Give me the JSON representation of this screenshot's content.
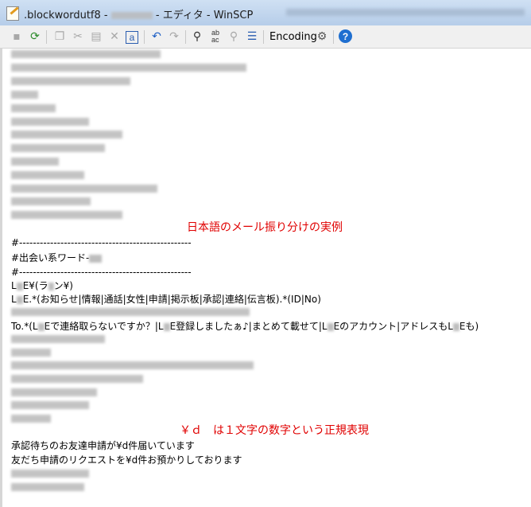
{
  "window": {
    "file_name": ".blockwordutf8 - ",
    "title_suffix": " - エディタ - WinSCP"
  },
  "toolbar": {
    "encoding_label": "Encoding",
    "help_label": "?"
  },
  "annotations": {
    "heading": "日本語のメール振り分けの実例",
    "regex_note": "￥ｄ　は１文字の数字という正規表現"
  },
  "editor": {
    "separator_1": "#--------------------------------------------------",
    "section_comment": "#出会い系ワード-",
    "separator_2": "#--------------------------------------------------",
    "line_line_a": "L",
    "line_line_b": "E¥(ラ",
    "line_line_c": "ン¥)",
    "line_keywords_a": "L",
    "line_keywords_b": "E.*(お知らせ|情報|通話|女性|申請|掲示板|承認|連絡|伝言板).*(ID|No)",
    "line_to_a": "To.*(L",
    "line_to_b": "Eで連絡取らないですか？|L",
    "line_to_c": "E登録しましたぁ♪|まとめて載せて|L",
    "line_to_d": "Eのアカウント|アドレスもL",
    "line_to_e": "Eも)",
    "line_approval": "承認待ちのお友達申請が¥d件届いています",
    "line_friend": "友だち申請のリクエストを¥d件お預かりしております"
  }
}
